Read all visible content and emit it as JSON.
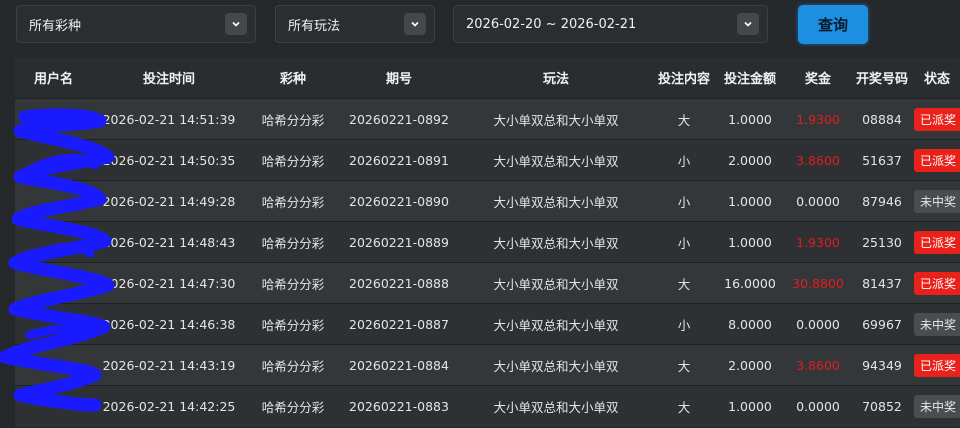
{
  "filters": {
    "lottery_select": "所有彩种",
    "playtype_select": "所有玩法",
    "date_range": "2026-02-20 ~ 2026-02-21",
    "query_label": "查询"
  },
  "colors": {
    "accent": "#1d8fe0",
    "prize_red": "#e11d1d",
    "status_paid_bg": "#e8211b",
    "status_lost_bg": "#4a4d50"
  },
  "table": {
    "headers": [
      "用户名",
      "投注时间",
      "彩种",
      "期号",
      "玩法",
      "投注内容",
      "投注金额",
      "奖金",
      "开奖号码",
      "状态"
    ],
    "rows": [
      {
        "user": "",
        "time": "2026-02-21 14:51:39",
        "lottery": "哈希分分彩",
        "issue": "20260221-0892",
        "play": "大小单双总和大小单双",
        "content": "大",
        "amount": "1.0000",
        "prize": "1.9300",
        "prize_win": true,
        "result": "08884",
        "status": "已派奖",
        "status_type": "paid"
      },
      {
        "user": "",
        "time": "2026-02-21 14:50:35",
        "lottery": "哈希分分彩",
        "issue": "20260221-0891",
        "play": "大小单双总和大小单双",
        "content": "小",
        "amount": "2.0000",
        "prize": "3.8600",
        "prize_win": true,
        "result": "51637",
        "status": "已派奖",
        "status_type": "paid"
      },
      {
        "user": "",
        "time": "2026-02-21 14:49:28",
        "lottery": "哈希分分彩",
        "issue": "20260221-0890",
        "play": "大小单双总和大小单双",
        "content": "小",
        "amount": "1.0000",
        "prize": "0.0000",
        "prize_win": false,
        "result": "87946",
        "status": "未中奖",
        "status_type": "lost"
      },
      {
        "user": "",
        "time": "2026-02-21 14:48:43",
        "lottery": "哈希分分彩",
        "issue": "20260221-0889",
        "play": "大小单双总和大小单双",
        "content": "小",
        "amount": "1.0000",
        "prize": "1.9300",
        "prize_win": true,
        "result": "25130",
        "status": "已派奖",
        "status_type": "paid"
      },
      {
        "user": "",
        "time": "2026-02-21 14:47:30",
        "lottery": "哈希分分彩",
        "issue": "20260221-0888",
        "play": "大小单双总和大小单双",
        "content": "大",
        "amount": "16.0000",
        "prize": "30.8800",
        "prize_win": true,
        "result": "81437",
        "status": "已派奖",
        "status_type": "paid"
      },
      {
        "user": "",
        "time": "2026-02-21 14:46:38",
        "lottery": "哈希分分彩",
        "issue": "20260221-0887",
        "play": "大小单双总和大小单双",
        "content": "小",
        "amount": "8.0000",
        "prize": "0.0000",
        "prize_win": false,
        "result": "69967",
        "status": "未中奖",
        "status_type": "lost"
      },
      {
        "user": "",
        "time": "2026-02-21 14:43:19",
        "lottery": "哈希分分彩",
        "issue": "20260221-0884",
        "play": "大小单双总和大小单双",
        "content": "大",
        "amount": "2.0000",
        "prize": "3.8600",
        "prize_win": true,
        "result": "94349",
        "status": "已派奖",
        "status_type": "paid"
      },
      {
        "user": "",
        "time": "2026-02-21 14:42:25",
        "lottery": "哈希分分彩",
        "issue": "20260221-0883",
        "play": "大小单双总和大小单双",
        "content": "大",
        "amount": "1.0000",
        "prize": "0.0000",
        "prize_win": false,
        "result": "70852",
        "status": "未中奖",
        "status_type": "lost"
      }
    ]
  }
}
